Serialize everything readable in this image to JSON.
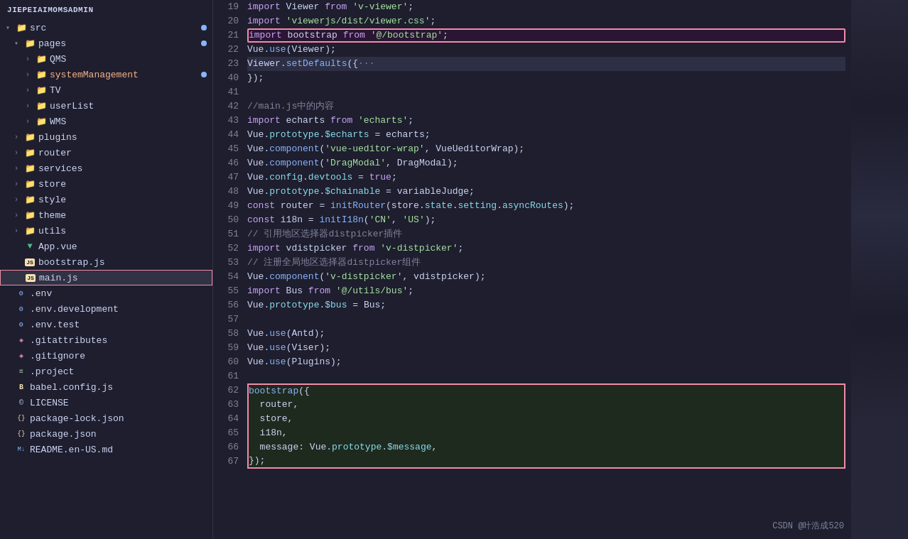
{
  "sidebar": {
    "title": "JIEPEIAIMOMSADMIN",
    "items": [
      {
        "id": "src",
        "label": "src",
        "type": "folder",
        "indent": 0,
        "arrow": "open",
        "badge": true
      },
      {
        "id": "pages",
        "label": "pages",
        "type": "folder",
        "indent": 1,
        "arrow": "open",
        "badge": true
      },
      {
        "id": "qms",
        "label": "QMS",
        "type": "folder",
        "indent": 2,
        "arrow": "closed"
      },
      {
        "id": "systemManagement",
        "label": "systemManagement",
        "type": "folder",
        "indent": 2,
        "arrow": "closed",
        "badge": true,
        "color": "orange"
      },
      {
        "id": "tv",
        "label": "TV",
        "type": "folder",
        "indent": 2,
        "arrow": "closed"
      },
      {
        "id": "userList",
        "label": "userList",
        "type": "folder",
        "indent": 2,
        "arrow": "closed"
      },
      {
        "id": "wms",
        "label": "WMS",
        "type": "folder",
        "indent": 2,
        "arrow": "closed"
      },
      {
        "id": "plugins",
        "label": "plugins",
        "type": "folder",
        "indent": 1,
        "arrow": "closed"
      },
      {
        "id": "router",
        "label": "router",
        "type": "folder",
        "indent": 1,
        "arrow": "closed"
      },
      {
        "id": "services",
        "label": "services",
        "type": "folder",
        "indent": 1,
        "arrow": "closed"
      },
      {
        "id": "store",
        "label": "store",
        "type": "folder",
        "indent": 1,
        "arrow": "closed"
      },
      {
        "id": "style",
        "label": "style",
        "type": "folder",
        "indent": 1,
        "arrow": "closed"
      },
      {
        "id": "theme",
        "label": "theme",
        "type": "folder",
        "indent": 1,
        "arrow": "closed"
      },
      {
        "id": "utils",
        "label": "utils",
        "type": "folder",
        "indent": 1,
        "arrow": "closed"
      },
      {
        "id": "appvue",
        "label": "App.vue",
        "type": "vue",
        "indent": 1,
        "arrow": "none"
      },
      {
        "id": "bootstrapjs",
        "label": "bootstrap.js",
        "type": "js",
        "indent": 1,
        "arrow": "none"
      },
      {
        "id": "mainjs",
        "label": "main.js",
        "type": "js",
        "indent": 1,
        "arrow": "none",
        "active": true
      },
      {
        "id": "env",
        "label": ".env",
        "type": "env",
        "indent": 0,
        "arrow": "none"
      },
      {
        "id": "envdev",
        "label": ".env.development",
        "type": "env",
        "indent": 0,
        "arrow": "none"
      },
      {
        "id": "envtest",
        "label": ".env.test",
        "type": "env",
        "indent": 0,
        "arrow": "none"
      },
      {
        "id": "gitattributes",
        "label": ".gitattributes",
        "type": "git",
        "indent": 0,
        "arrow": "none"
      },
      {
        "id": "gitignore",
        "label": ".gitignore",
        "type": "git",
        "indent": 0,
        "arrow": "none"
      },
      {
        "id": "project",
        "label": ".project",
        "type": "project",
        "indent": 0,
        "arrow": "none"
      },
      {
        "id": "babelconfig",
        "label": "babel.config.js",
        "type": "babel",
        "indent": 0,
        "arrow": "none"
      },
      {
        "id": "license",
        "label": "LICENSE",
        "type": "license",
        "indent": 0,
        "arrow": "none"
      },
      {
        "id": "packagelockjson",
        "label": "package-lock.json",
        "type": "json",
        "indent": 0,
        "arrow": "none"
      },
      {
        "id": "packagejson",
        "label": "package.json",
        "type": "json",
        "indent": 0,
        "arrow": "none"
      },
      {
        "id": "readme",
        "label": "README.en-US.md",
        "type": "md",
        "indent": 0,
        "arrow": "none"
      }
    ]
  },
  "editor": {
    "lines": [
      {
        "num": 19,
        "tokens": [
          {
            "t": "kw",
            "v": "import "
          },
          {
            "t": "var",
            "v": "Viewer "
          },
          {
            "t": "kw",
            "v": "from "
          },
          {
            "t": "str",
            "v": "'v-viewer'"
          },
          {
            "t": "punc",
            "v": ";"
          }
        ]
      },
      {
        "num": 20,
        "tokens": [
          {
            "t": "kw",
            "v": "import "
          },
          {
            "t": "str",
            "v": "'viewerjs/dist/viewer.css'"
          },
          {
            "t": "punc",
            "v": ";"
          }
        ]
      },
      {
        "num": 21,
        "tokens": [
          {
            "t": "kw",
            "v": "import "
          },
          {
            "t": "var",
            "v": "bootstrap "
          },
          {
            "t": "kw",
            "v": "from "
          },
          {
            "t": "str",
            "v": "'@/bootstrap'"
          },
          {
            "t": "punc",
            "v": ";"
          }
        ],
        "boxed": true
      },
      {
        "num": 22,
        "tokens": [
          {
            "t": "var",
            "v": "Vue"
          },
          {
            "t": "punc",
            "v": "."
          },
          {
            "t": "fn",
            "v": "use"
          },
          {
            "t": "punc",
            "v": "("
          },
          {
            "t": "var",
            "v": "Viewer"
          },
          {
            "t": "punc",
            "v": ")"
          },
          {
            "t": "punc",
            "v": ";"
          }
        ]
      },
      {
        "num": 23,
        "tokens": [
          {
            "t": "var",
            "v": "Viewer"
          },
          {
            "t": "punc",
            "v": "."
          },
          {
            "t": "fn",
            "v": "setDefaults"
          },
          {
            "t": "punc",
            "v": "({"
          },
          {
            "t": "cm",
            "v": "···"
          }
        ],
        "collapsed": true,
        "highlight": true
      },
      {
        "num": 40,
        "tokens": [
          {
            "t": "punc",
            "v": "});"
          }
        ]
      },
      {
        "num": 41,
        "tokens": []
      },
      {
        "num": 42,
        "tokens": [
          {
            "t": "cm",
            "v": "//main.js中的内容"
          }
        ]
      },
      {
        "num": 43,
        "tokens": [
          {
            "t": "kw",
            "v": "import "
          },
          {
            "t": "var",
            "v": "echarts "
          },
          {
            "t": "kw",
            "v": "from "
          },
          {
            "t": "str",
            "v": "'echarts'"
          },
          {
            "t": "punc",
            "v": ";"
          }
        ]
      },
      {
        "num": 44,
        "tokens": [
          {
            "t": "var",
            "v": "Vue"
          },
          {
            "t": "punc",
            "v": "."
          },
          {
            "t": "prop",
            "v": "prototype"
          },
          {
            "t": "punc",
            "v": "."
          },
          {
            "t": "prop",
            "v": "$echarts"
          },
          {
            "t": "punc",
            "v": " = "
          },
          {
            "t": "var",
            "v": "echarts"
          },
          {
            "t": "punc",
            "v": ";"
          }
        ]
      },
      {
        "num": 45,
        "tokens": [
          {
            "t": "var",
            "v": "Vue"
          },
          {
            "t": "punc",
            "v": "."
          },
          {
            "t": "fn",
            "v": "component"
          },
          {
            "t": "punc",
            "v": "("
          },
          {
            "t": "str",
            "v": "'vue-ueditor-wrap'"
          },
          {
            "t": "punc",
            "v": ", "
          },
          {
            "t": "var",
            "v": "VueUeditorWrap"
          },
          {
            "t": "punc",
            "v": ")"
          },
          {
            "t": "punc",
            "v": ";"
          }
        ]
      },
      {
        "num": 46,
        "tokens": [
          {
            "t": "var",
            "v": "Vue"
          },
          {
            "t": "punc",
            "v": "."
          },
          {
            "t": "fn",
            "v": "component"
          },
          {
            "t": "punc",
            "v": "("
          },
          {
            "t": "str",
            "v": "'DragModal'"
          },
          {
            "t": "punc",
            "v": ", "
          },
          {
            "t": "var",
            "v": "DragModal"
          },
          {
            "t": "punc",
            "v": ")"
          },
          {
            "t": "punc",
            "v": ";"
          }
        ]
      },
      {
        "num": 47,
        "tokens": [
          {
            "t": "var",
            "v": "Vue"
          },
          {
            "t": "punc",
            "v": "."
          },
          {
            "t": "prop",
            "v": "config"
          },
          {
            "t": "punc",
            "v": "."
          },
          {
            "t": "prop",
            "v": "devtools"
          },
          {
            "t": "punc",
            "v": " = "
          },
          {
            "t": "kw",
            "v": "true"
          },
          {
            "t": "punc",
            "v": ";"
          }
        ]
      },
      {
        "num": 48,
        "tokens": [
          {
            "t": "var",
            "v": "Vue"
          },
          {
            "t": "punc",
            "v": "."
          },
          {
            "t": "prop",
            "v": "prototype"
          },
          {
            "t": "punc",
            "v": "."
          },
          {
            "t": "prop",
            "v": "$chainable"
          },
          {
            "t": "punc",
            "v": " = "
          },
          {
            "t": "var",
            "v": "variableJudge"
          },
          {
            "t": "punc",
            "v": ";"
          }
        ]
      },
      {
        "num": 49,
        "tokens": [
          {
            "t": "kw",
            "v": "const "
          },
          {
            "t": "var",
            "v": "router"
          },
          {
            "t": "punc",
            "v": " = "
          },
          {
            "t": "fn",
            "v": "initRouter"
          },
          {
            "t": "punc",
            "v": "("
          },
          {
            "t": "var",
            "v": "store"
          },
          {
            "t": "punc",
            "v": "."
          },
          {
            "t": "prop",
            "v": "state"
          },
          {
            "t": "punc",
            "v": "."
          },
          {
            "t": "prop",
            "v": "setting"
          },
          {
            "t": "punc",
            "v": "."
          },
          {
            "t": "prop",
            "v": "asyncRoutes"
          },
          {
            "t": "punc",
            "v": ")"
          },
          {
            "t": "punc",
            "v": ";"
          }
        ]
      },
      {
        "num": 50,
        "tokens": [
          {
            "t": "kw",
            "v": "const "
          },
          {
            "t": "var",
            "v": "i18n"
          },
          {
            "t": "punc",
            "v": " = "
          },
          {
            "t": "fn",
            "v": "initI18n"
          },
          {
            "t": "punc",
            "v": "("
          },
          {
            "t": "str",
            "v": "'CN'"
          },
          {
            "t": "punc",
            "v": ", "
          },
          {
            "t": "str",
            "v": "'US'"
          },
          {
            "t": "punc",
            "v": ")"
          },
          {
            "t": "punc",
            "v": ";"
          }
        ]
      },
      {
        "num": 51,
        "tokens": [
          {
            "t": "cm",
            "v": "// 引用地区选择器distpicker插件"
          }
        ]
      },
      {
        "num": 52,
        "tokens": [
          {
            "t": "kw",
            "v": "import "
          },
          {
            "t": "var",
            "v": "vdistpicker "
          },
          {
            "t": "kw",
            "v": "from "
          },
          {
            "t": "str",
            "v": "'v-distpicker'"
          },
          {
            "t": "punc",
            "v": ";"
          }
        ]
      },
      {
        "num": 53,
        "tokens": [
          {
            "t": "cm",
            "v": "// 注册全局地区选择器distpicker组件"
          }
        ]
      },
      {
        "num": 54,
        "tokens": [
          {
            "t": "var",
            "v": "Vue"
          },
          {
            "t": "punc",
            "v": "."
          },
          {
            "t": "fn",
            "v": "component"
          },
          {
            "t": "punc",
            "v": "("
          },
          {
            "t": "str",
            "v": "'v-distpicker'"
          },
          {
            "t": "punc",
            "v": ", "
          },
          {
            "t": "var",
            "v": "vdistpicker"
          },
          {
            "t": "punc",
            "v": ")"
          },
          {
            "t": "punc",
            "v": ";"
          }
        ]
      },
      {
        "num": 55,
        "tokens": [
          {
            "t": "kw",
            "v": "import "
          },
          {
            "t": "var",
            "v": "Bus "
          },
          {
            "t": "kw",
            "v": "from "
          },
          {
            "t": "str",
            "v": "'@/utils/bus'"
          },
          {
            "t": "punc",
            "v": ";"
          }
        ]
      },
      {
        "num": 56,
        "tokens": [
          {
            "t": "var",
            "v": "Vue"
          },
          {
            "t": "punc",
            "v": "."
          },
          {
            "t": "prop",
            "v": "prototype"
          },
          {
            "t": "punc",
            "v": "."
          },
          {
            "t": "prop",
            "v": "$bus"
          },
          {
            "t": "punc",
            "v": " = "
          },
          {
            "t": "var",
            "v": "Bus"
          },
          {
            "t": "punc",
            "v": ";"
          }
        ]
      },
      {
        "num": 57,
        "tokens": []
      },
      {
        "num": 58,
        "tokens": [
          {
            "t": "var",
            "v": "Vue"
          },
          {
            "t": "punc",
            "v": "."
          },
          {
            "t": "fn",
            "v": "use"
          },
          {
            "t": "punc",
            "v": "("
          },
          {
            "t": "var",
            "v": "Antd"
          },
          {
            "t": "punc",
            "v": ")"
          },
          {
            "t": "punc",
            "v": ";"
          }
        ]
      },
      {
        "num": 59,
        "tokens": [
          {
            "t": "var",
            "v": "Vue"
          },
          {
            "t": "punc",
            "v": "."
          },
          {
            "t": "fn",
            "v": "use"
          },
          {
            "t": "punc",
            "v": "("
          },
          {
            "t": "var",
            "v": "Viser"
          },
          {
            "t": "punc",
            "v": ")"
          },
          {
            "t": "punc",
            "v": ";"
          }
        ]
      },
      {
        "num": 60,
        "tokens": [
          {
            "t": "var",
            "v": "Vue"
          },
          {
            "t": "punc",
            "v": "."
          },
          {
            "t": "fn",
            "v": "use"
          },
          {
            "t": "punc",
            "v": "("
          },
          {
            "t": "var",
            "v": "Plugins"
          },
          {
            "t": "punc",
            "v": ")"
          },
          {
            "t": "punc",
            "v": ";"
          }
        ]
      },
      {
        "num": 61,
        "tokens": []
      },
      {
        "num": 62,
        "tokens": [
          {
            "t": "fn",
            "v": "bootstrap"
          },
          {
            "t": "punc",
            "v": "({"
          }
        ],
        "box2_start": true
      },
      {
        "num": 63,
        "tokens": [
          {
            "t": "var",
            "v": "  router"
          },
          {
            "t": "punc",
            "v": ","
          }
        ],
        "box2_mid": true
      },
      {
        "num": 64,
        "tokens": [
          {
            "t": "var",
            "v": "  store"
          },
          {
            "t": "punc",
            "v": ","
          }
        ],
        "box2_mid": true
      },
      {
        "num": 65,
        "tokens": [
          {
            "t": "var",
            "v": "  i18n"
          },
          {
            "t": "punc",
            "v": ","
          }
        ],
        "box2_mid": true
      },
      {
        "num": 66,
        "tokens": [
          {
            "t": "var",
            "v": "  message"
          },
          {
            "t": "punc",
            "v": ": "
          },
          {
            "t": "var",
            "v": "Vue"
          },
          {
            "t": "punc",
            "v": "."
          },
          {
            "t": "prop",
            "v": "prototype"
          },
          {
            "t": "punc",
            "v": "."
          },
          {
            "t": "prop",
            "v": "$message"
          },
          {
            "t": "punc",
            "v": ","
          }
        ],
        "box2_mid": true
      },
      {
        "num": 67,
        "tokens": [
          {
            "t": "punc",
            "v": "});"
          }
        ],
        "box2_end": true
      }
    ]
  },
  "watermark": "CSDN @叶浩成520"
}
